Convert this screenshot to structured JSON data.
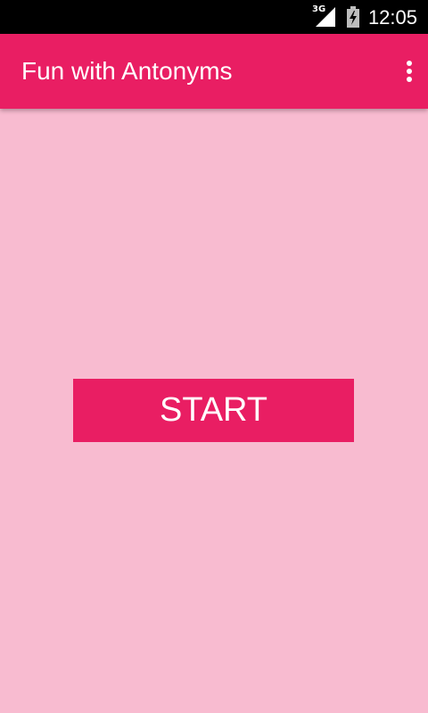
{
  "status_bar": {
    "network_type": "3G",
    "time": "12:05",
    "icons": [
      "signal-icon",
      "battery-charging-icon"
    ]
  },
  "app_bar": {
    "title": "Fun with Antonyms",
    "menu_icon": "overflow-menu-icon"
  },
  "main": {
    "start_label": "START"
  },
  "colors": {
    "primary": "#E91E63",
    "background": "#F8BBD0",
    "status_bar": "#000000",
    "on_primary": "#FFFFFF"
  }
}
